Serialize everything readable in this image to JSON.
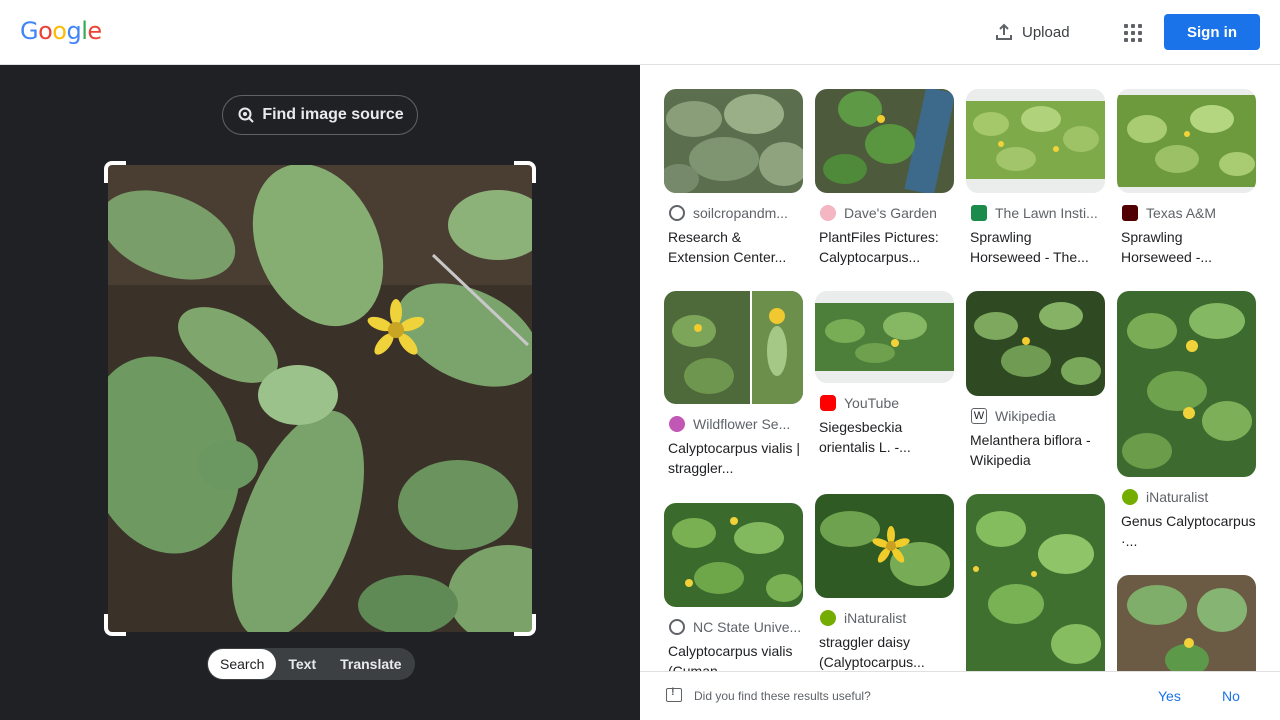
{
  "header": {
    "logo_letters": [
      {
        "ch": "G",
        "color": "#4285F4"
      },
      {
        "ch": "o",
        "color": "#EA4335"
      },
      {
        "ch": "o",
        "color": "#FBBC05"
      },
      {
        "ch": "g",
        "color": "#4285F4"
      },
      {
        "ch": "l",
        "color": "#34A853"
      },
      {
        "ch": "e",
        "color": "#EA4335"
      }
    ],
    "upload_label": "Upload",
    "signin_label": "Sign in",
    "accent": "#1a73e8"
  },
  "left": {
    "find_label": "Find image source",
    "modes": [
      {
        "label": "Search",
        "active": true
      },
      {
        "label": "Text",
        "active": false
      },
      {
        "label": "Translate",
        "active": false
      }
    ]
  },
  "results": [
    {
      "source": "soilcropandm...",
      "title": "Research & Extension Center...",
      "icon": "globe-icon"
    },
    {
      "source": "Dave's Garden",
      "title": "PlantFiles Pictures: Calyptocarpus...",
      "icon": "daves-garden-icon"
    },
    {
      "source": "The Lawn Insti...",
      "title": "Sprawling Horseweed - The...",
      "icon": "lawn-institute-icon"
    },
    {
      "source": "Texas A&M",
      "title": "Sprawling Horseweed -...",
      "icon": "texas-am-icon"
    },
    {
      "source": "Wildflower Se...",
      "title": "Calyptocarpus vialis | straggler...",
      "icon": "wildflower-icon"
    },
    {
      "source": "YouTube",
      "title": "Siegesbeckia orientalis L. -...",
      "icon": "youtube-icon"
    },
    {
      "source": "Wikipedia",
      "title": "Melanthera biflora - Wikipedia",
      "icon": "wikipedia-icon"
    },
    {
      "source": "iNaturalist",
      "title": "Genus Calyptocarpus ·...",
      "icon": "inaturalist-icon"
    },
    {
      "source": "NC State Unive...",
      "title": "Calyptocarpus vialis (Cuman...",
      "icon": "globe-icon"
    },
    {
      "source": "iNaturalist",
      "title": "straggler daisy (Calyptocarpus...",
      "icon": "inaturalist-icon"
    }
  ],
  "feedback": {
    "question": "Did you find these results useful?",
    "yes_label": "Yes",
    "no_label": "No"
  }
}
